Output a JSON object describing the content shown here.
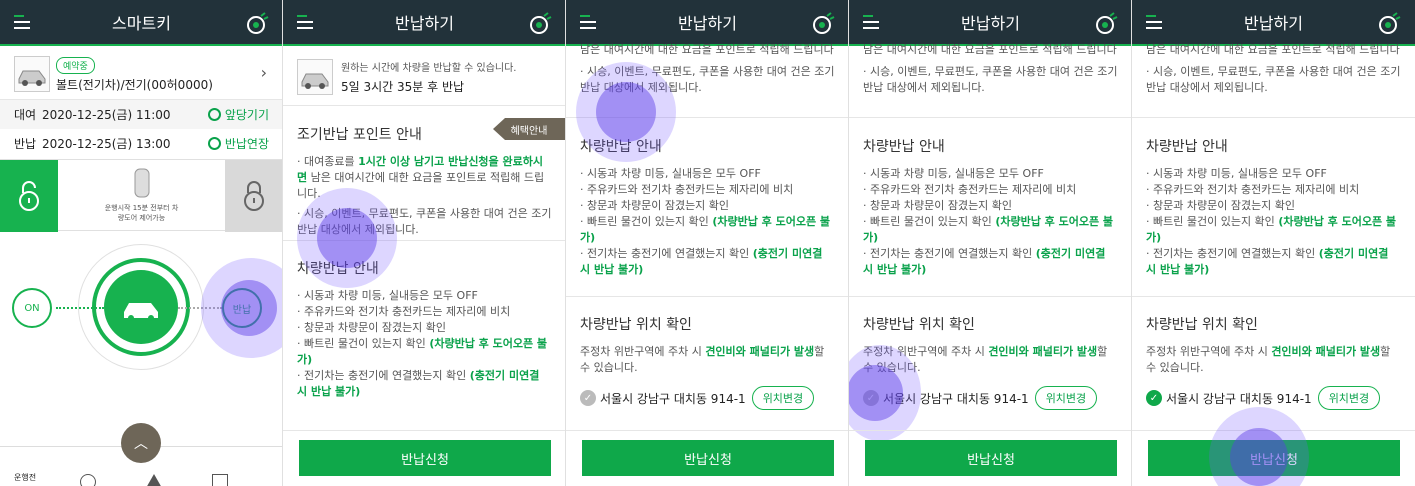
{
  "panels": [
    {
      "title": "스마트키"
    },
    {
      "title": "반납하기"
    },
    {
      "title": "반납하기"
    },
    {
      "title": "반납하기"
    },
    {
      "title": "반납하기"
    }
  ],
  "smartkey": {
    "badge": "예약중",
    "car_name": "볼트(전기차)/전기(00허0000)",
    "rental_label": "대여",
    "rental_time": "2020-12-25(금) 11:00",
    "rental_action": "앞당기기",
    "return_label": "반납",
    "return_time": "2020-12-25(금) 13:00",
    "return_action": "반납연장",
    "lock_note": "운행시작 15분 전부터 차\n량도어 제어가능",
    "on_label": "ON",
    "return_btn_label": "반납",
    "bottom_label": "운행전"
  },
  "return": {
    "summary_small": "원하는 시간에 차량을 반납할 수 있습니다.",
    "summary_big": "5일 3시간 35분 후 반납",
    "benefit_tag": "혜택안내",
    "early_title": "조기반납 포인트 안내",
    "early_b1_pre": "· 대여종료를 ",
    "early_b1_green": "1시간 이상 남기고 반납신청을 완료하시면",
    "early_b1_post": " 남은 대여시간에 대한 요금을 포인트로 적립해 드립니다.",
    "early_b2": "· 시승, 이벤트, 무료편도, 쿠폰을 사용한 대여 건은 조기반납 대상에서 제외됩니다.",
    "early_b1_cut": "남은 대여시간에 대한 요금을 포인트로 적립해 드립니다",
    "guide_title": "차량반납 안내",
    "guide_b1": "· 시동과 차량 미등, 실내등은 모두 OFF",
    "guide_b2": "· 주유카드와 전기차 충전카드는 제자리에 비치",
    "guide_b3": "· 창문과 차량문이 잠겼는지 확인",
    "guide_b4_pre": "· 빠트린 물건이 있는지 확인 ",
    "guide_b4_green": "(차량반납 후 도어오픈 불가)",
    "guide_b5_pre": "· 전기차는 충전기에 연결했는지 확인 ",
    "guide_b5_green": "(충전기 미연결 시 반납 불가)",
    "loc_title": "차량반납 위치 확인",
    "loc_desc_pre": "주정차 위반구역에 주차 시 ",
    "loc_desc_green": "견인비와 패널티가 발생",
    "loc_desc_post": "할 수 있습니다.",
    "address": "서울시 강남구 대치동 914-1",
    "change_btn": "위치변경",
    "apply_btn": "반납신청"
  },
  "colors": {
    "accent": "#17b24f",
    "header": "#22323a",
    "apply": "#0fa84a",
    "touch": "#7a5aff"
  }
}
